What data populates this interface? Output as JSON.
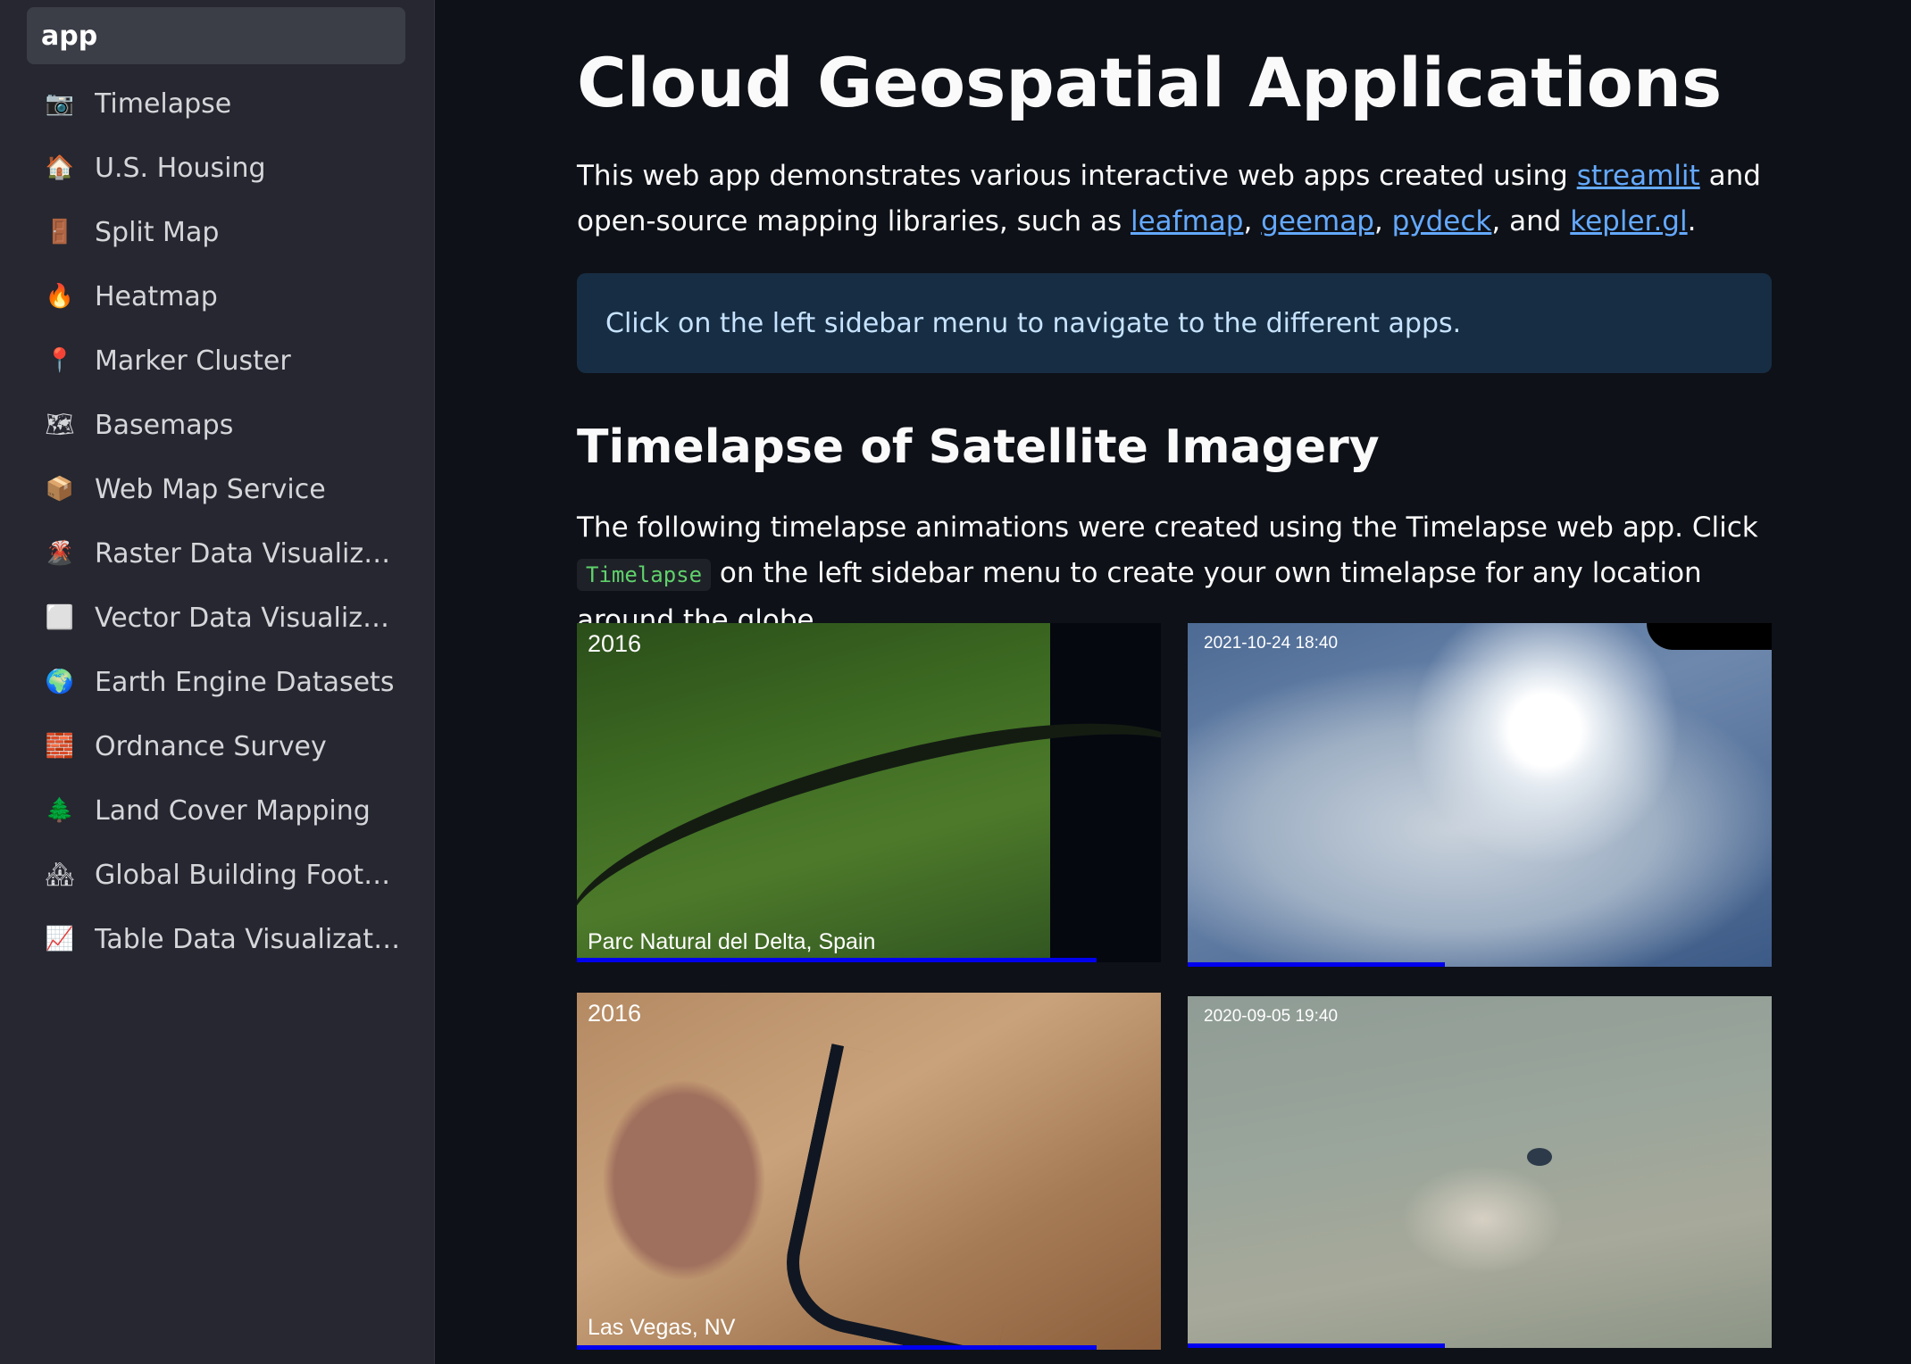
{
  "sidebar": {
    "items": [
      {
        "label": "app",
        "icon": "",
        "active": true
      },
      {
        "label": "Timelapse",
        "icon": "camera-icon",
        "glyph": "📷"
      },
      {
        "label": "U.S. Housing",
        "icon": "house-icon",
        "glyph": "🏠"
      },
      {
        "label": "Split Map",
        "icon": "door-icon",
        "glyph": "🚪"
      },
      {
        "label": "Heatmap",
        "icon": "fire-icon",
        "glyph": "🔥"
      },
      {
        "label": "Marker Cluster",
        "icon": "pin-icon",
        "glyph": "📍"
      },
      {
        "label": "Basemaps",
        "icon": "map-icon",
        "glyph": "🗺"
      },
      {
        "label": "Web Map Service",
        "icon": "package-icon",
        "glyph": "📦"
      },
      {
        "label": "Raster Data Visualization",
        "icon": "volcano-icon",
        "glyph": "🌋"
      },
      {
        "label": "Vector Data Visualization",
        "icon": "square-icon",
        "glyph": "⬜"
      },
      {
        "label": "Earth Engine Datasets",
        "icon": "globe-icon",
        "glyph": "🌍"
      },
      {
        "label": "Ordnance Survey",
        "icon": "bricks-icon",
        "glyph": "🧱"
      },
      {
        "label": "Land Cover Mapping",
        "icon": "tree-icon",
        "glyph": "🌲"
      },
      {
        "label": "Global Building Footpr…",
        "icon": "houses-icon",
        "glyph": "🏘"
      },
      {
        "label": "Table Data Visualization",
        "icon": "chart-icon",
        "glyph": "📈"
      }
    ]
  },
  "main": {
    "title": "Cloud Geospatial Applications",
    "intro": {
      "before": "This web app demonstrates various interactive web apps created using ",
      "link_streamlit": "streamlit",
      "middle": " and open-source mapping libraries, such as ",
      "link_leafmap": "leafmap",
      "sep1": ", ",
      "link_geemap": "geemap",
      "sep2": ", ",
      "link_pydeck": "pydeck",
      "sep3": ", and ",
      "link_kepler": "kepler.gl",
      "end": "."
    },
    "info": "Click on the left sidebar menu to navigate to the different apps.",
    "section_title": "Timelapse of Satellite Imagery",
    "section_text": {
      "before": "The following timelapse animations were created using the Timelapse web app. Click ",
      "code": "Timelapse",
      "after": " on the left sidebar menu to create your own timelapse for any location around the globe."
    },
    "tiles": [
      {
        "top_label": "2016",
        "bottom_label": "Parc Natural del Delta, Spain",
        "progress": 0.89
      },
      {
        "top_label": "2021-10-24 18:40",
        "bottom_label": "",
        "progress": 0.44
      },
      {
        "top_label": "2016",
        "bottom_label": "Las Vegas, NV",
        "progress": 0.89
      },
      {
        "top_label": "2020-09-05 19:40",
        "bottom_label": "",
        "progress": 0.44
      }
    ]
  }
}
